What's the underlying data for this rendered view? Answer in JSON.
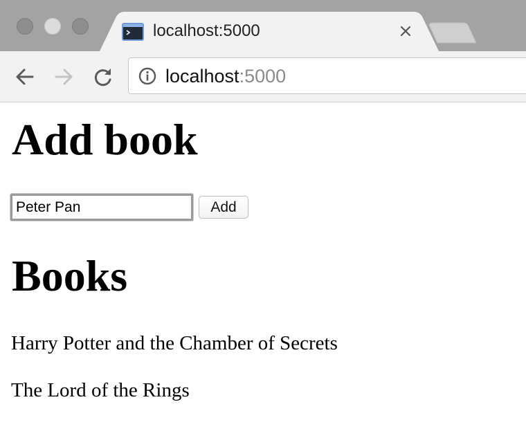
{
  "browser": {
    "tab": {
      "title": "localhost:5000",
      "favicon": "terminal-icon",
      "close_icon": "close-icon"
    },
    "address_bar": {
      "host": "localhost",
      "port": ":5000",
      "info_icon": "info-icon"
    },
    "nav": {
      "back_icon": "arrow-left-icon",
      "forward_icon": "arrow-right-icon",
      "reload_icon": "reload-icon"
    }
  },
  "page": {
    "add_heading": "Add book",
    "input_value": "Peter Pan",
    "add_button_label": "Add",
    "books_heading": "Books",
    "books": [
      "Harry Potter and the Chamber of Secrets",
      "The Lord of the Rings"
    ]
  },
  "colors": {
    "tabstrip": "#a3a3a3",
    "active_tab": "#f2f2f2",
    "toolbar": "#f2f2f2",
    "url_port": "#8a8a8a"
  }
}
